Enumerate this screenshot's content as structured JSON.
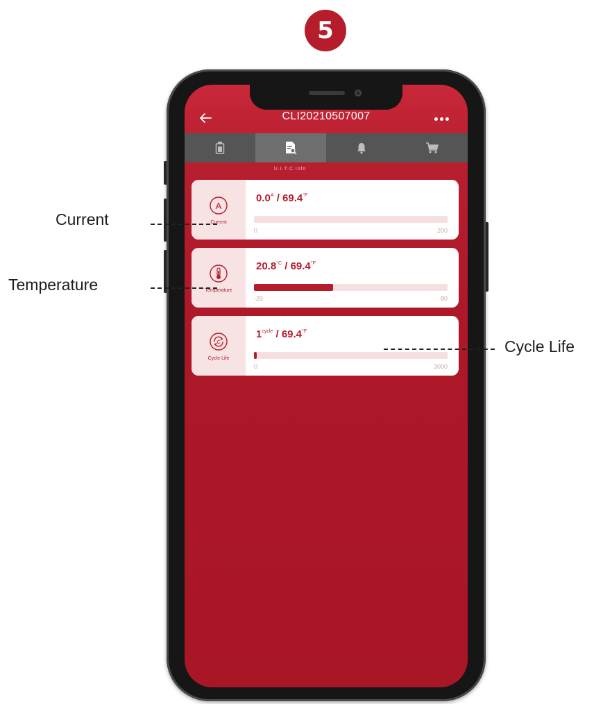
{
  "step_number": "5",
  "header": {
    "title": "CLI20210507007"
  },
  "tabs": [
    {
      "id": "battery",
      "icon": "battery-icon",
      "active": false
    },
    {
      "id": "info",
      "icon": "document-search-icon",
      "active": true
    },
    {
      "id": "alarm",
      "icon": "bell-icon",
      "active": false
    },
    {
      "id": "cart",
      "icon": "cart-icon",
      "active": false
    }
  ],
  "tab_caption": "U.I.T.C info",
  "cards": [
    {
      "label": "Current",
      "icon": "current-a-icon",
      "value": "0.0",
      "value_unit": "A",
      "ref_value": "69.4",
      "ref_unit": "°F",
      "min": "0",
      "max": "200",
      "fill_fraction": 0.0
    },
    {
      "label": "Temperature",
      "icon": "thermometer-icon",
      "value": "20.8",
      "value_unit": "°C",
      "ref_value": "69.4",
      "ref_unit": "°F",
      "min": "-20",
      "max": "80",
      "fill_fraction": 0.41
    },
    {
      "label": "Cycle Life",
      "icon": "cycle-icon",
      "value": "1",
      "value_unit": "cycle",
      "ref_value": "69.4",
      "ref_unit": "°F",
      "min": "0",
      "max": "3000",
      "fill_fraction": 0.0003
    }
  ],
  "callouts": {
    "current": "Current",
    "temperature": "Temperature",
    "cycle_life": "Cycle Life"
  },
  "colors": {
    "brand_red": "#b51d2b",
    "tab_bar": "#555555",
    "card_side": "#f7e2e4"
  }
}
